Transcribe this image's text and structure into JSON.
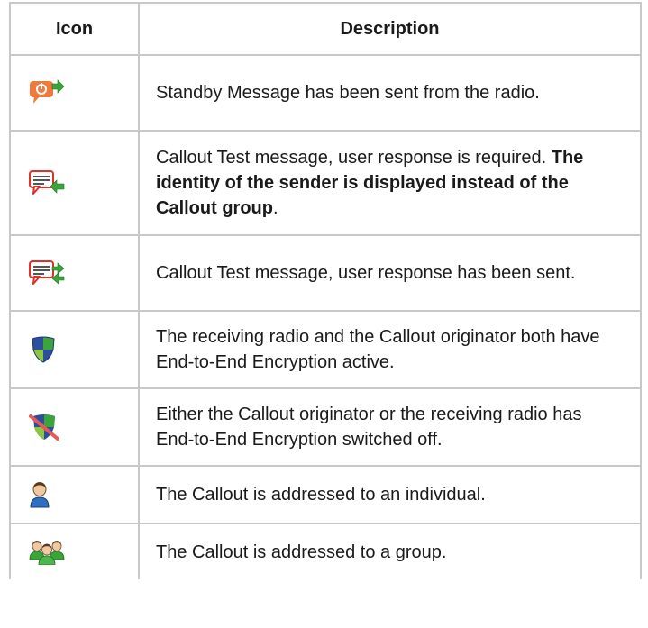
{
  "header": {
    "icon_col": "Icon",
    "description_col": "Description"
  },
  "rows": [
    {
      "icon": "standby-sent-icon",
      "text": "Standby Message has been sent from the radio."
    },
    {
      "icon": "callout-test-response-required-icon",
      "text": "Callout Test message, user response is required. ",
      "bold": "The identity of the sender is displayed instead of the Callout group",
      "tail": "."
    },
    {
      "icon": "callout-test-response-sent-icon",
      "text": "Callout Test message, user response has been sent."
    },
    {
      "icon": "encryption-active-shield-icon",
      "text": "The receiving radio and the Callout originator both have End-to-End Encryption active."
    },
    {
      "icon": "encryption-off-shield-icon",
      "text": "Either the Callout originator or the receiving radio has End-to-End Encryption switched off."
    },
    {
      "icon": "individual-user-icon",
      "text": "The Callout is addressed to an individual."
    },
    {
      "icon": "group-users-icon",
      "text": "The Callout is addressed to a group."
    }
  ],
  "colors": {
    "border": "#c8c8c8",
    "orange": "#f07a3c",
    "red": "#e0302a",
    "green": "#3aa63a"
  }
}
